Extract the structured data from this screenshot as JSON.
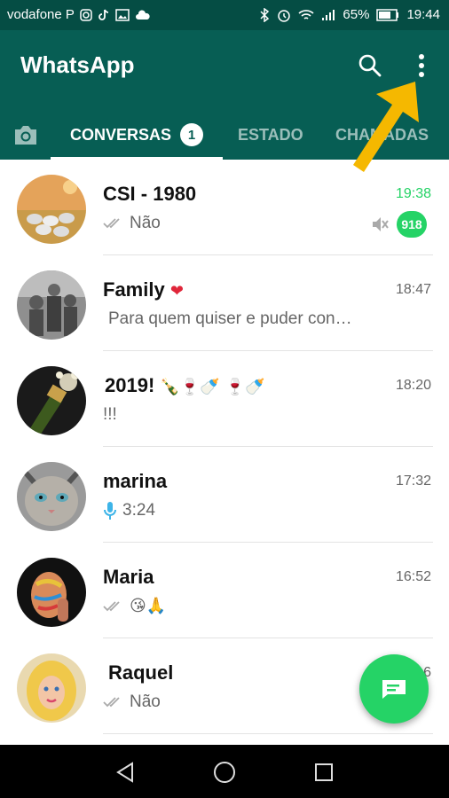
{
  "statusbar": {
    "carrier": "vodafone P",
    "battery": "65%",
    "time": "19:44"
  },
  "appbar": {
    "title": "WhatsApp"
  },
  "tabs": [
    {
      "label": "CONVERSAS",
      "badge": "1"
    },
    {
      "label": "ESTADO"
    },
    {
      "label": "CHAMADAS"
    }
  ],
  "chats": [
    {
      "name": "CSI - 1980",
      "time": "19:38",
      "preview": "Não",
      "unread": "918"
    },
    {
      "name": "Family",
      "name_emoji": "❤",
      "time": "18:47",
      "preview": "Para quem quiser e puder con…"
    },
    {
      "name": "2019!",
      "name_emoji": "🍾🍷🍼        🍷🍼",
      "time": "18:20",
      "preview": "!!!"
    },
    {
      "name": "marina",
      "time": "17:32",
      "preview": "3:24"
    },
    {
      "name": "Maria",
      "time": "16:52",
      "preview": "😘🙏"
    },
    {
      "name": "Raquel",
      "time": "16",
      "preview": "Não"
    }
  ],
  "colors": {
    "header": "#075e54",
    "statusbar": "#054d44",
    "accent": "#25d366",
    "arrow": "#f5b800"
  }
}
